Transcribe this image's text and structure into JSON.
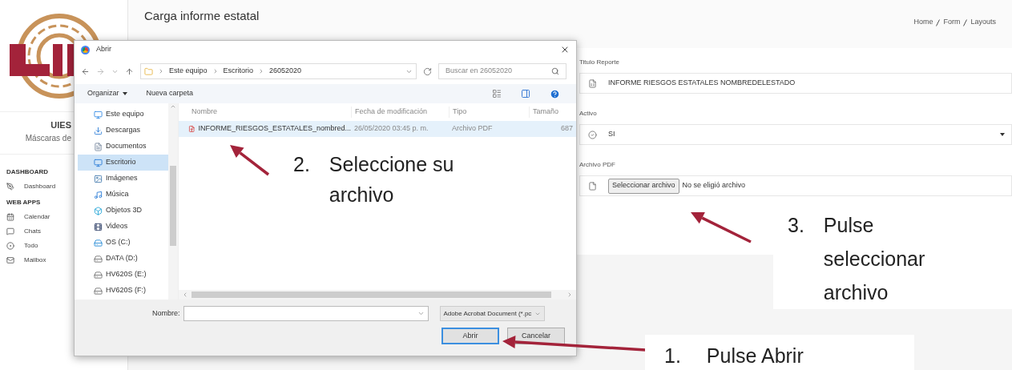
{
  "sidebar": {
    "brand": "UIES",
    "subtitle": "Máscaras de",
    "sections": [
      {
        "title": "DASHBOARD",
        "items": [
          {
            "label": "Dashboard"
          }
        ]
      },
      {
        "title": "WEB APPS",
        "items": [
          {
            "label": "Calendar"
          },
          {
            "label": "Chats"
          },
          {
            "label": "Todo"
          },
          {
            "label": "Mailbox"
          }
        ]
      }
    ]
  },
  "page": {
    "title": "Carga informe estatal",
    "breadcrumb": [
      "Home",
      "Form",
      "Layouts"
    ]
  },
  "form": {
    "title_field": {
      "label": "Titulo Reporte",
      "value": "INFORME RIESGOS ESTATALES NOMBREDELESTADO"
    },
    "active_field": {
      "label": "Activo",
      "value": "SI"
    },
    "file_field": {
      "label": "Archivo PDF",
      "button": "Seleccionar archivo",
      "status": "No se eligió archivo"
    }
  },
  "dialog": {
    "title": "Abrir",
    "path": [
      "Este equipo",
      "Escritorio",
      "26052020"
    ],
    "search_placeholder": "Buscar en 26052020",
    "toolbar": [
      "Organizar",
      "Nueva carpeta"
    ],
    "tree": [
      {
        "label": "Este equipo",
        "selected": false
      },
      {
        "label": "Descargas",
        "selected": false
      },
      {
        "label": "Documentos",
        "selected": false
      },
      {
        "label": "Escritorio",
        "selected": true
      },
      {
        "label": "Imágenes",
        "selected": false
      },
      {
        "label": "Música",
        "selected": false
      },
      {
        "label": "Objetos 3D",
        "selected": false
      },
      {
        "label": "Videos",
        "selected": false
      },
      {
        "label": "OS (C:)",
        "selected": false
      },
      {
        "label": "DATA (D:)",
        "selected": false
      },
      {
        "label": "HV620S (E:)",
        "selected": false
      },
      {
        "label": "HV620S (F:)",
        "selected": false
      }
    ],
    "columns": [
      "Nombre",
      "Fecha de modificación",
      "Tipo",
      "Tamaño"
    ],
    "files": [
      {
        "name": "INFORME_RIESGOS_ESTATALES_nombred...",
        "modified": "26/05/2020 03:45 p. m.",
        "type": "Archivo PDF",
        "size": "687",
        "selected": true
      }
    ],
    "name_label": "Nombre:",
    "filter": "Adobe Acrobat Document (*.pc",
    "buttons": [
      "Abrir",
      "Cancelar"
    ]
  },
  "annotations": [
    {
      "number": "2.",
      "text": "Seleccione su archivo"
    },
    {
      "number": "3.",
      "text": "Pulse seleccionar archivo"
    },
    {
      "number": "1.",
      "text": "Pulse Abrir"
    }
  ]
}
